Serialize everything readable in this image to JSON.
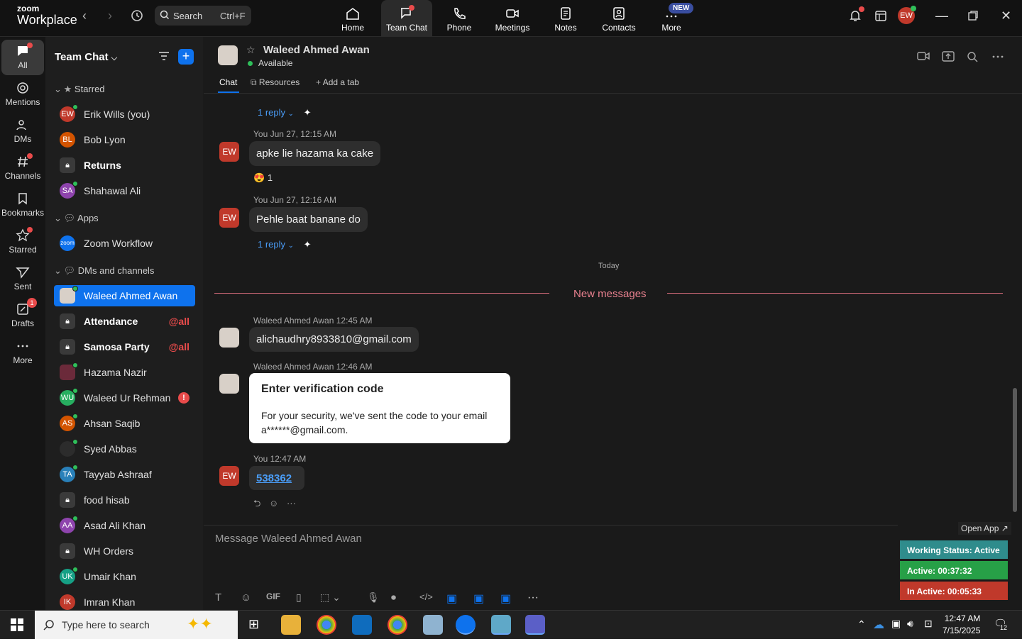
{
  "app": {
    "logo_line1": "zoom",
    "logo_line2": "Workplace"
  },
  "search": {
    "label": "Search",
    "shortcut": "Ctrl+F"
  },
  "top_nav": [
    {
      "label": "Home",
      "icon": "home-icon"
    },
    {
      "label": "Team Chat",
      "icon": "team-chat-icon"
    },
    {
      "label": "Phone",
      "icon": "phone-icon"
    },
    {
      "label": "Meetings",
      "icon": "meetings-icon"
    },
    {
      "label": "Notes",
      "icon": "notes-icon"
    },
    {
      "label": "Contacts",
      "icon": "contacts-icon"
    },
    {
      "label": "More",
      "icon": "more-icon",
      "badge": "NEW"
    }
  ],
  "user_avatar": "EW",
  "rail": [
    {
      "label": "All"
    },
    {
      "label": "Mentions"
    },
    {
      "label": "DMs"
    },
    {
      "label": "Channels"
    },
    {
      "label": "Bookmarks"
    },
    {
      "label": "Starred"
    },
    {
      "label": "Sent"
    },
    {
      "label": "Drafts",
      "badge": "1"
    },
    {
      "label": "More"
    }
  ],
  "sidebar": {
    "title": "Team Chat",
    "sections": {
      "starred": "Starred",
      "apps": "Apps",
      "dms": "DMs and channels"
    },
    "starred": [
      {
        "initials": "EW",
        "name": "Erik Wills (you)",
        "color": "#c0392b"
      },
      {
        "initials": "BL",
        "name": "Bob Lyon",
        "color": "#d35400"
      },
      {
        "initials": "",
        "name": "Returns",
        "bold": true
      },
      {
        "initials": "SA",
        "name": "Shahawal Ali",
        "color": "#8e44ad"
      }
    ],
    "apps": [
      {
        "initials": "zoom",
        "name": "Zoom Workflow",
        "color": "#0e72ed"
      }
    ],
    "dms": [
      {
        "initials": "",
        "name": "Waleed Ahmed Awan",
        "selected": true
      },
      {
        "initials": "",
        "name": "Attendance",
        "bold": true,
        "tag": "@all"
      },
      {
        "initials": "",
        "name": "Samosa Party",
        "bold": true,
        "tag": "@all"
      },
      {
        "initials": "",
        "name": "Hazama Nazir",
        "color": "#6b2a3a"
      },
      {
        "initials": "WU",
        "name": "Waleed Ur Rehman",
        "color": "#27ae60",
        "alert": "!"
      },
      {
        "initials": "AS",
        "name": "Ahsan Saqib",
        "color": "#d35400"
      },
      {
        "initials": "",
        "name": "Syed Abbas",
        "color": "#2c2c2c"
      },
      {
        "initials": "TA",
        "name": "Tayyab Ashraaf",
        "color": "#2980b9"
      },
      {
        "initials": "",
        "name": "food hisab"
      },
      {
        "initials": "AA",
        "name": "Asad Ali Khan",
        "color": "#8e44ad"
      },
      {
        "initials": "",
        "name": "WH Orders"
      },
      {
        "initials": "UK",
        "name": "Umair Khan",
        "color": "#16a085"
      },
      {
        "initials": "IK",
        "name": "Imran Khan",
        "color": "#c0392b"
      }
    ]
  },
  "chat": {
    "name": "Waleed Ahmed Awan",
    "status": "Available",
    "tabs": [
      "Chat",
      "Resources",
      "Add a tab"
    ],
    "reply1": "1 reply",
    "msg1_meta": "You Jun 27, 12:15 AM",
    "msg1_text": "apke lie hazama ka cake",
    "msg1_reaction": "1",
    "msg2_meta": "You Jun 27, 12:16 AM",
    "msg2_text": "Pehle baat banane do",
    "reply2": "1 reply",
    "divider_today": "Today",
    "new_messages": "New messages",
    "msg3_meta": "Waleed Ahmed Awan 12:45 AM",
    "msg3_text": "alichaudhry8933810@gmail.com",
    "msg4_meta": "Waleed Ahmed Awan 12:46 AM",
    "card_title": "Enter verification code",
    "card_body": "For your security, we've sent the code to your email a******@gmail.com.",
    "msg5_meta": "You 12:47 AM",
    "msg5_code": "538362",
    "composer_placeholder": "Message Waleed Ahmed Awan",
    "gif": "GIF"
  },
  "tracker": {
    "open_app": "Open App ↗",
    "working": "Working Status: Active",
    "active": "Active: 00:37:32",
    "inactive": "In Active: 00:05:33"
  },
  "taskbar": {
    "search_placeholder": "Type here to search",
    "time": "12:47 AM",
    "date": "7/15/2025",
    "notif": "12"
  }
}
